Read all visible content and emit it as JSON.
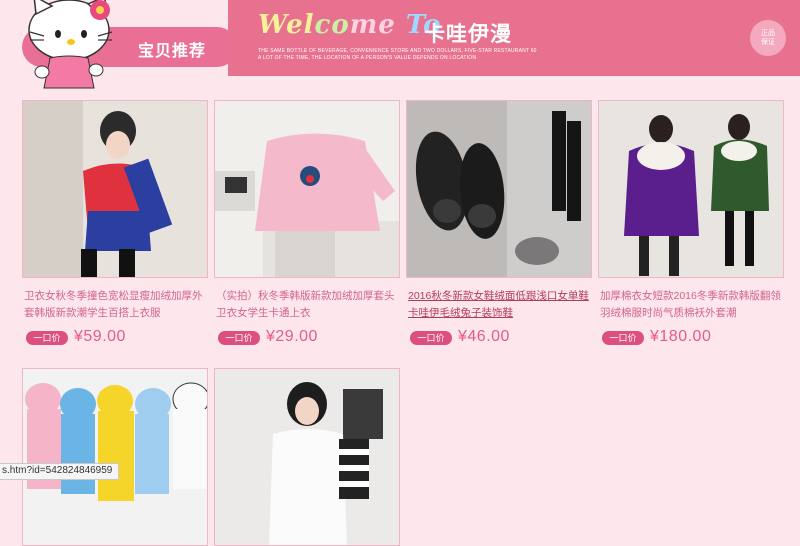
{
  "header": {
    "section_title": "宝贝推荐",
    "welcome_parts": [
      "Wel",
      "co",
      "me",
      " "
    ],
    "welcome_to": "To",
    "brand": "卡哇伊漫",
    "tagline": "THE SAME BOTTLE OF BEVERAGE, CONVENIENCE STORE AND TWO DOLLARS, FIVE-STAR RESTAURANT 60 A LOT OF THE TIME, THE LOCATION OF A PERSON'S VALUE DEPENDS ON LOCATION",
    "guarantee_line1": "正品",
    "guarantee_line2": "保证"
  },
  "price_tag_label": "一口价",
  "products": [
    {
      "title": "卫衣女秋冬季撞色宽松显瘦加绒加厚外套韩版新款潮学生百搭上衣服",
      "price": "¥59.00"
    },
    {
      "title": "（实拍）秋冬季韩版新款加绒加厚套头卫衣女学生卡通上衣",
      "price": "¥29.00"
    },
    {
      "title": "2016秋冬新款女鞋绒面低跟浅口女单鞋卡哇伊毛绒兔子装饰鞋",
      "price": "¥46.00"
    },
    {
      "title": "加厚棉衣女短款2016冬季新款韩版翻领羽绒棉服时尚气质棉袄外套潮",
      "price": "¥180.00"
    },
    {
      "title": "",
      "price": ""
    },
    {
      "title": "",
      "price": ""
    }
  ],
  "status_bar": "s.htm?id=542824846959",
  "colors": {
    "accent": "#e8718f",
    "price": "#e85a87",
    "tag": "#dd4f7f",
    "background": "#fde6ec"
  }
}
